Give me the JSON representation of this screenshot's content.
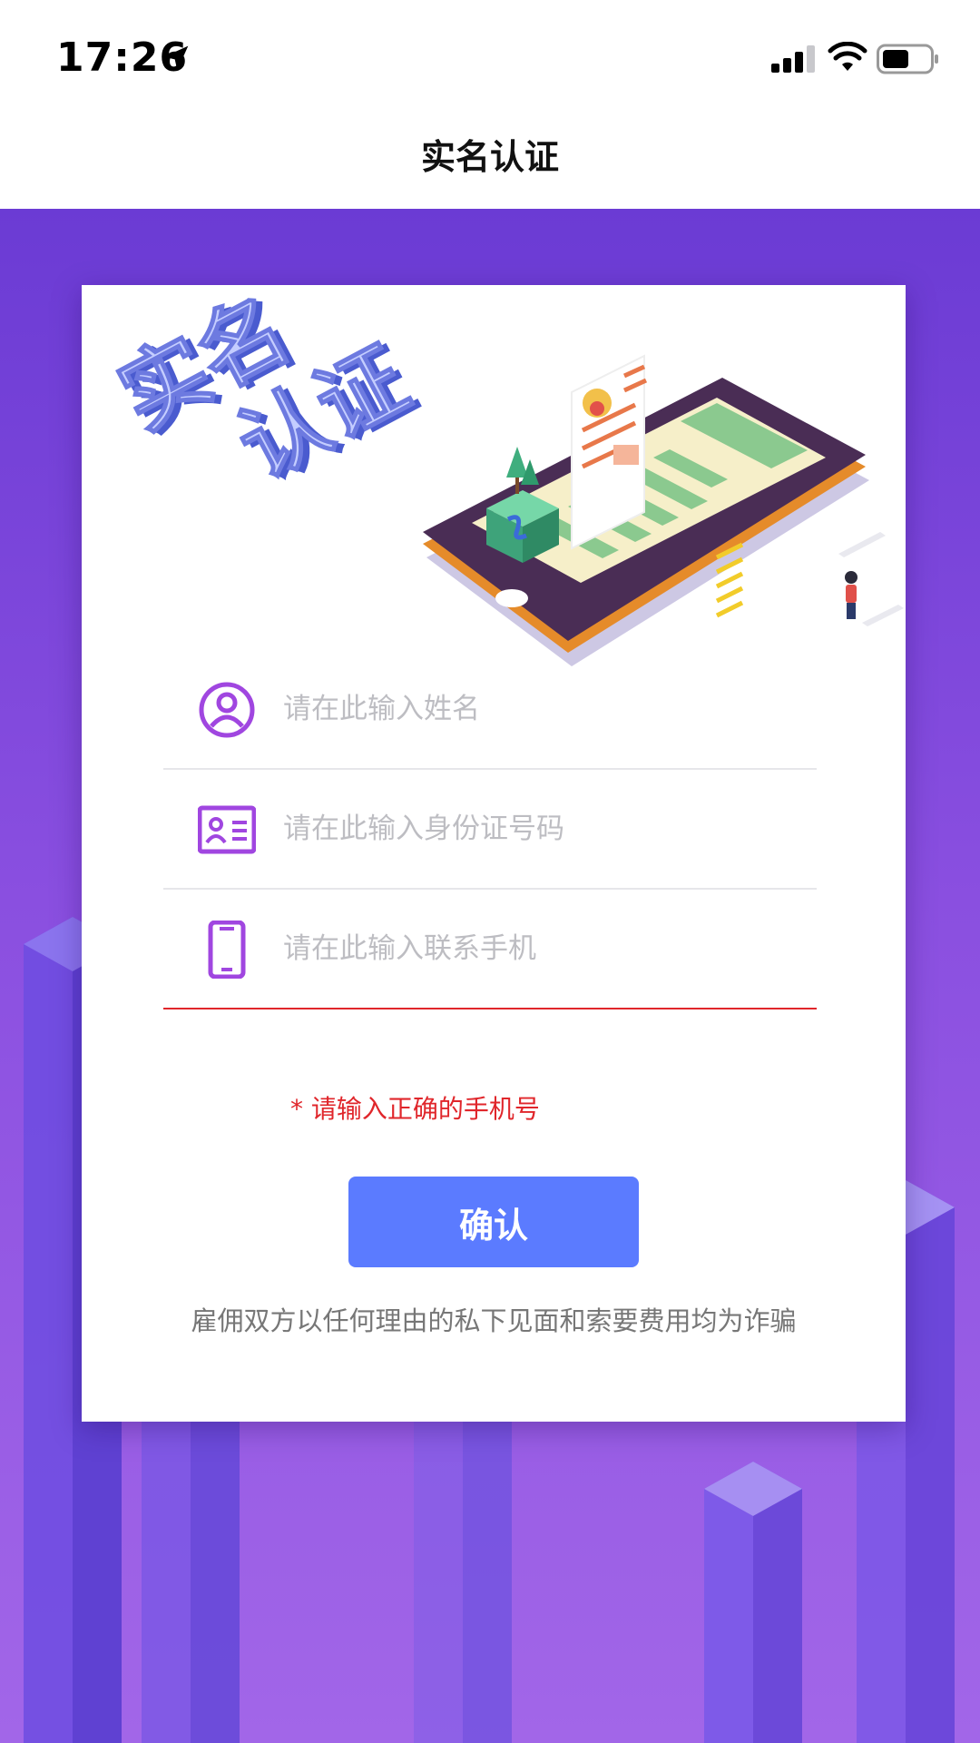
{
  "status_bar": {
    "time": "17:26",
    "icons": [
      "location-arrow-icon",
      "cellular-signal-icon",
      "wifi-icon",
      "battery-icon"
    ]
  },
  "nav": {
    "title": "实名认证"
  },
  "hero": {
    "title_art": "实名认证"
  },
  "form": {
    "name_field": {
      "placeholder": "请在此输入姓名",
      "value": "",
      "icon": "user-circle-icon"
    },
    "id_field": {
      "placeholder": "请在此输入身份证号码",
      "value": "",
      "icon": "id-card-icon"
    },
    "phone_field": {
      "placeholder": "请在此输入联系手机",
      "value": "",
      "icon": "mobile-phone-icon"
    },
    "error_text": "* 请输入正确的手机号",
    "confirm_label": "确认",
    "notice": "雇佣双方以任何理由的私下见面和索要费用均为诈骗"
  },
  "colors": {
    "accent": "#5b7bff",
    "icon_purple": "#a046e0",
    "error": "#e0262b",
    "bg_top": "#6b3bd4",
    "bg_bottom": "#a266e8"
  }
}
